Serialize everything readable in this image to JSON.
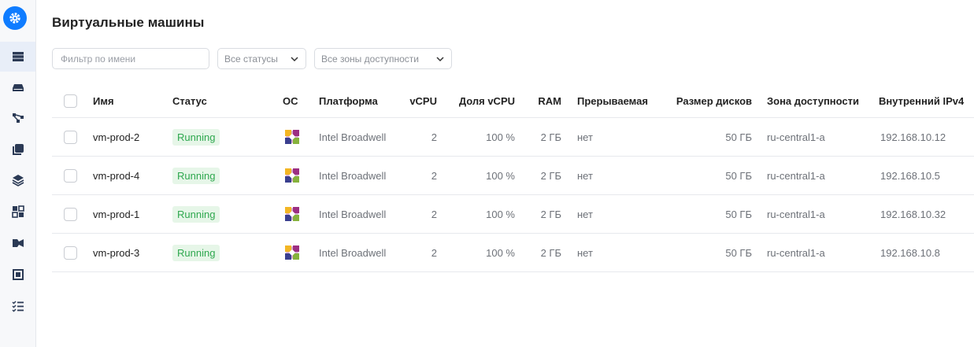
{
  "page": {
    "title": "Виртуальные машины"
  },
  "sidebar": {
    "logo_icon": "gear-icon",
    "items": [
      {
        "icon": "server-icon",
        "active": true
      },
      {
        "icon": "disk-icon"
      },
      {
        "icon": "network-icon"
      },
      {
        "icon": "images-icon"
      },
      {
        "icon": "layers-icon"
      },
      {
        "icon": "placement-icon"
      },
      {
        "icon": "snapshot-icon"
      },
      {
        "icon": "frame-icon"
      },
      {
        "icon": "operations-list-icon"
      }
    ]
  },
  "filters": {
    "name_placeholder": "Фильтр по имени",
    "status_label": "Все статусы",
    "zone_label": "Все зоны доступности"
  },
  "table": {
    "columns": {
      "name": "Имя",
      "status": "Статус",
      "os": "ОС",
      "platform": "Платформа",
      "vcpu": "vCPU",
      "vcpu_share": "Доля vCPU",
      "ram": "RAM",
      "preemptible": "Прерываемая",
      "disk_size": "Размер дисков",
      "zone": "Зона доступности",
      "ipv4": "Внутренний IPv4"
    },
    "rows": [
      {
        "name": "vm-prod-2",
        "status": "Running",
        "os_icon": "centos-icon",
        "platform": "Intel Broadwell",
        "vcpu": "2",
        "vcpu_share": "100 %",
        "ram": "2 ГБ",
        "preemptible": "нет",
        "disk_size": "50 ГБ",
        "zone": "ru-central1-a",
        "ipv4": "192.168.10.12"
      },
      {
        "name": "vm-prod-4",
        "status": "Running",
        "os_icon": "centos-icon",
        "platform": "Intel Broadwell",
        "vcpu": "2",
        "vcpu_share": "100 %",
        "ram": "2 ГБ",
        "preemptible": "нет",
        "disk_size": "50 ГБ",
        "zone": "ru-central1-a",
        "ipv4": "192.168.10.5"
      },
      {
        "name": "vm-prod-1",
        "status": "Running",
        "os_icon": "centos-icon",
        "platform": "Intel Broadwell",
        "vcpu": "2",
        "vcpu_share": "100 %",
        "ram": "2 ГБ",
        "preemptible": "нет",
        "disk_size": "50 ГБ",
        "zone": "ru-central1-a",
        "ipv4": "192.168.10.32"
      },
      {
        "name": "vm-prod-3",
        "status": "Running",
        "os_icon": "centos-icon",
        "platform": "Intel Broadwell",
        "vcpu": "2",
        "vcpu_share": "100 %",
        "ram": "2 ГБ",
        "preemptible": "нет",
        "disk_size": "50 ГБ",
        "zone": "ru-central1-a",
        "ipv4": "192.168.10.8"
      }
    ]
  },
  "colors": {
    "accent": "#0f7cff",
    "status_running_bg": "#e6f6e8",
    "status_running_text": "#2fa84f"
  }
}
